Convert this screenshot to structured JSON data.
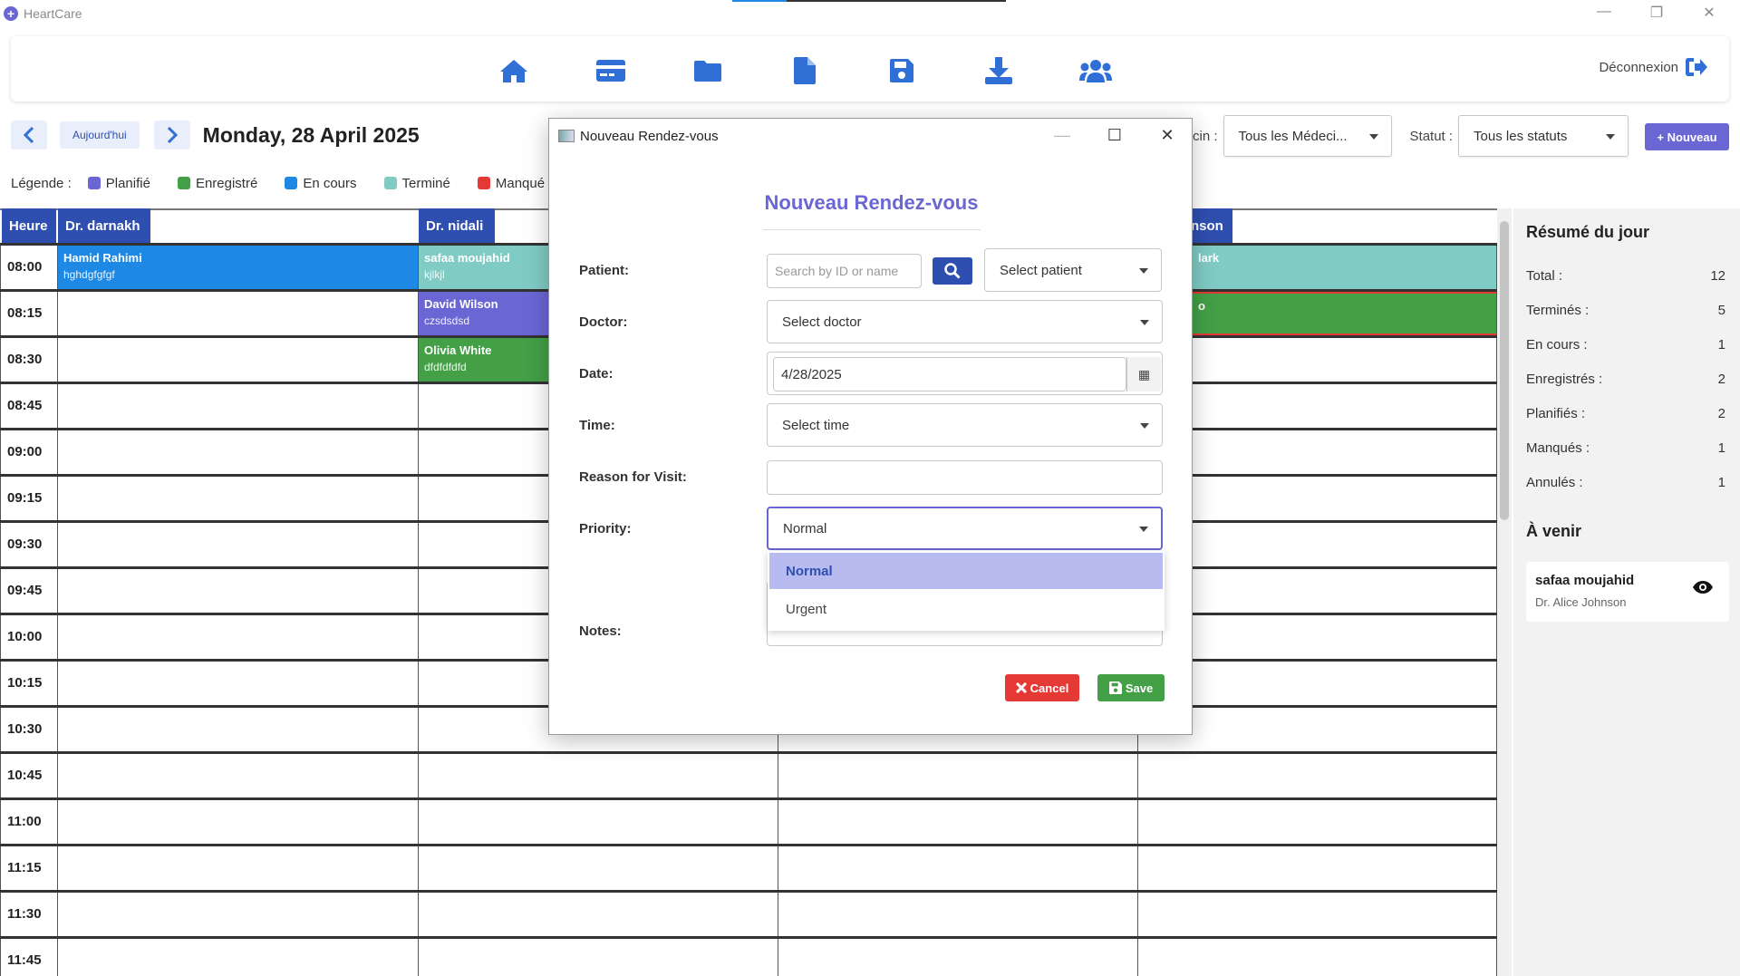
{
  "window": {
    "title": "HeartCare",
    "minimize": "—",
    "restore": "❐",
    "close": "✕"
  },
  "toolbar": {
    "icons": [
      "home-icon",
      "card-icon",
      "folder-icon",
      "document-icon",
      "save-icon",
      "download-icon",
      "users-icon"
    ],
    "logout_label": "Déconnexion"
  },
  "datebar": {
    "prev": "<",
    "today": "Aujourd'hui",
    "next": ">",
    "date": "Monday, 28 April 2025"
  },
  "filters": {
    "doctor_label": "cin :",
    "doctor_value": "Tous les Médeci...",
    "status_label": "Statut :",
    "status_value": "Tous les statuts",
    "new_button": "+ Nouveau"
  },
  "legend": {
    "title": "Légende :",
    "items": [
      {
        "label": "Planifié",
        "color": "#6a66d4"
      },
      {
        "label": "Enregistré",
        "color": "#43a047"
      },
      {
        "label": "En cours",
        "color": "#1e88e5"
      },
      {
        "label": "Terminé",
        "color": "#80cbc4"
      },
      {
        "label": "Manqué",
        "color": "#e53935"
      }
    ]
  },
  "calendar": {
    "hour_header": "Heure",
    "doctors": [
      "Dr. darnakh",
      "Dr. nidali",
      "",
      "nson"
    ],
    "times": [
      "08:00",
      "08:15",
      "08:30",
      "08:45",
      "09:00",
      "09:15",
      "09:30",
      "09:45",
      "10:00",
      "10:15",
      "10:30",
      "10:45",
      "11:00",
      "11:15",
      "11:30",
      "11:45"
    ],
    "appointments": [
      {
        "name": "Hamid Rahimi",
        "note": "hghdgfgfgf",
        "color": "#1e88e5"
      },
      {
        "name": "safaa moujahid",
        "note": "kjlkjl",
        "color": "#80cbc4"
      },
      {
        "name": "David Wilson",
        "note": "czsdsdsd",
        "color": "#6a66d4"
      },
      {
        "name": "Olivia White",
        "note": "dfdfdfdfd",
        "color": "#43a047"
      },
      {
        "name": "lark",
        "note": "",
        "color": "#80cbc4"
      },
      {
        "name": "o",
        "note": "",
        "color": "#43a047"
      }
    ]
  },
  "summary": {
    "title": "Résumé du jour",
    "stats": [
      {
        "label": "Total :",
        "value": "12"
      },
      {
        "label": "Terminés :",
        "value": "5"
      },
      {
        "label": "En cours :",
        "value": "1"
      },
      {
        "label": "Enregistrés :",
        "value": "2"
      },
      {
        "label": "Planifiés :",
        "value": "2"
      },
      {
        "label": "Manqués :",
        "value": "1"
      },
      {
        "label": "Annulés :",
        "value": "1"
      }
    ],
    "upcoming_title": "À venir",
    "upcoming": {
      "name": "safaa moujahid",
      "doctor": "Dr. Alice Johnson"
    }
  },
  "modal": {
    "window_title": "Nouveau Rendez-vous",
    "heading": "Nouveau Rendez-vous",
    "labels": {
      "patient": "Patient:",
      "doctor": "Doctor:",
      "date": "Date:",
      "time": "Time:",
      "reason": "Reason for Visit:",
      "priority": "Priority:",
      "notes": "Notes:"
    },
    "search_placeholder": "Search by ID or name",
    "patient_select": "Select patient",
    "doctor_select": "Select doctor",
    "date_value": "4/28/2025",
    "time_select": "Select time",
    "reason_value": "",
    "priority_value": "Normal",
    "priority_options": [
      "Normal",
      "Urgent"
    ],
    "cancel": "Cancel",
    "save": "Save"
  }
}
